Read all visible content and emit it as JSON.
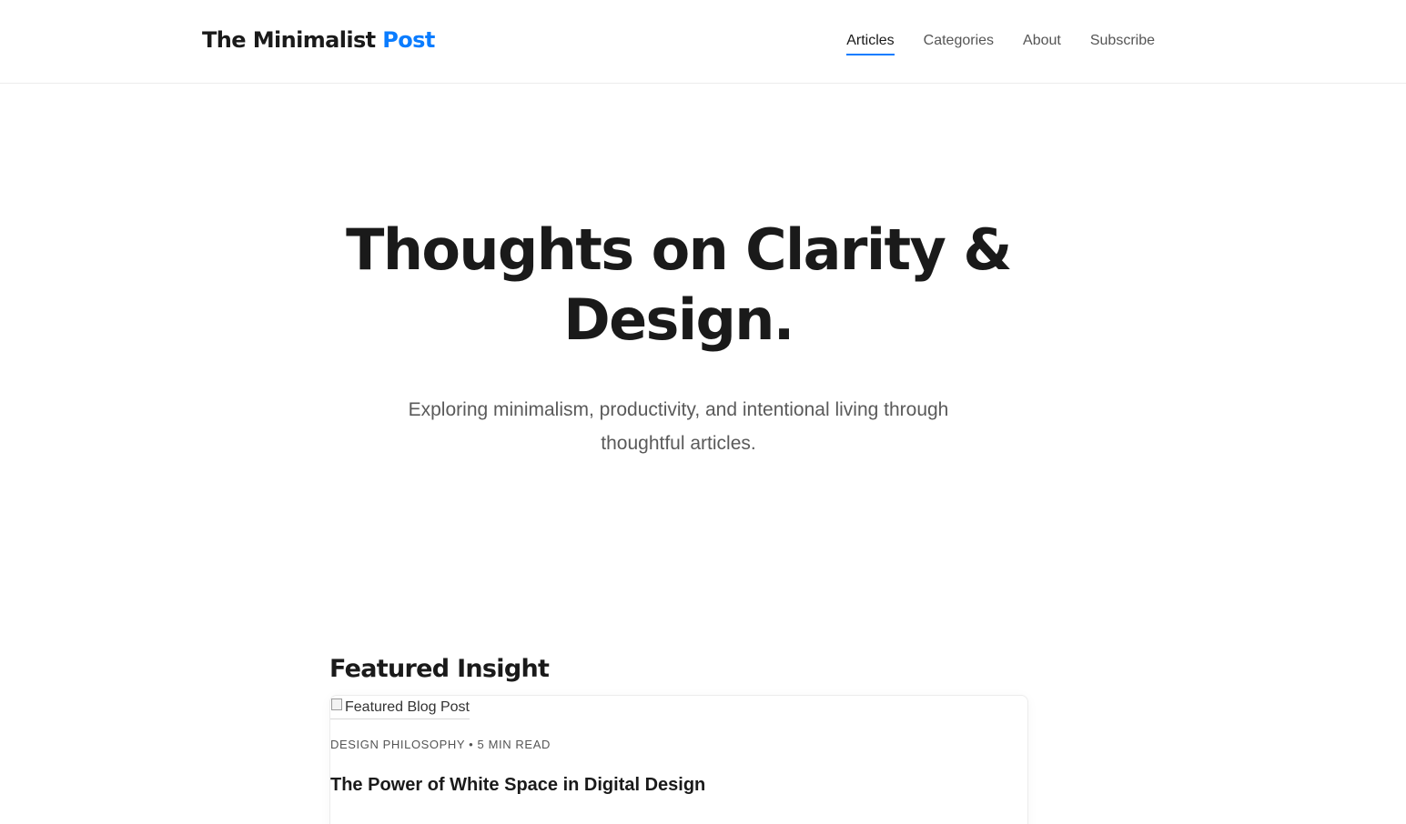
{
  "header": {
    "logo_main": "The Minimalist ",
    "logo_accent": "Post",
    "nav": [
      {
        "label": "Articles",
        "active": true
      },
      {
        "label": "Categories",
        "active": false
      },
      {
        "label": "About",
        "active": false
      },
      {
        "label": "Subscribe",
        "active": false
      }
    ]
  },
  "hero": {
    "title_line1": "Thoughts on Clarity &",
    "title_line2": "Design.",
    "subtitle_line1": "Exploring minimalism, productivity, and intentional living through",
    "subtitle_line2": "thoughtful articles."
  },
  "featured": {
    "section_title": "Featured Insight",
    "image_alt": "Featured Blog Post",
    "category": "Design Philosophy",
    "separator": "•",
    "read_time": "5 min read",
    "title": "The Power of White Space in Digital Design",
    "icon": "broken-image-icon"
  },
  "colors": {
    "accent": "#0a7cff",
    "text": "#1a1a1a",
    "muted": "#5a5a5a"
  }
}
